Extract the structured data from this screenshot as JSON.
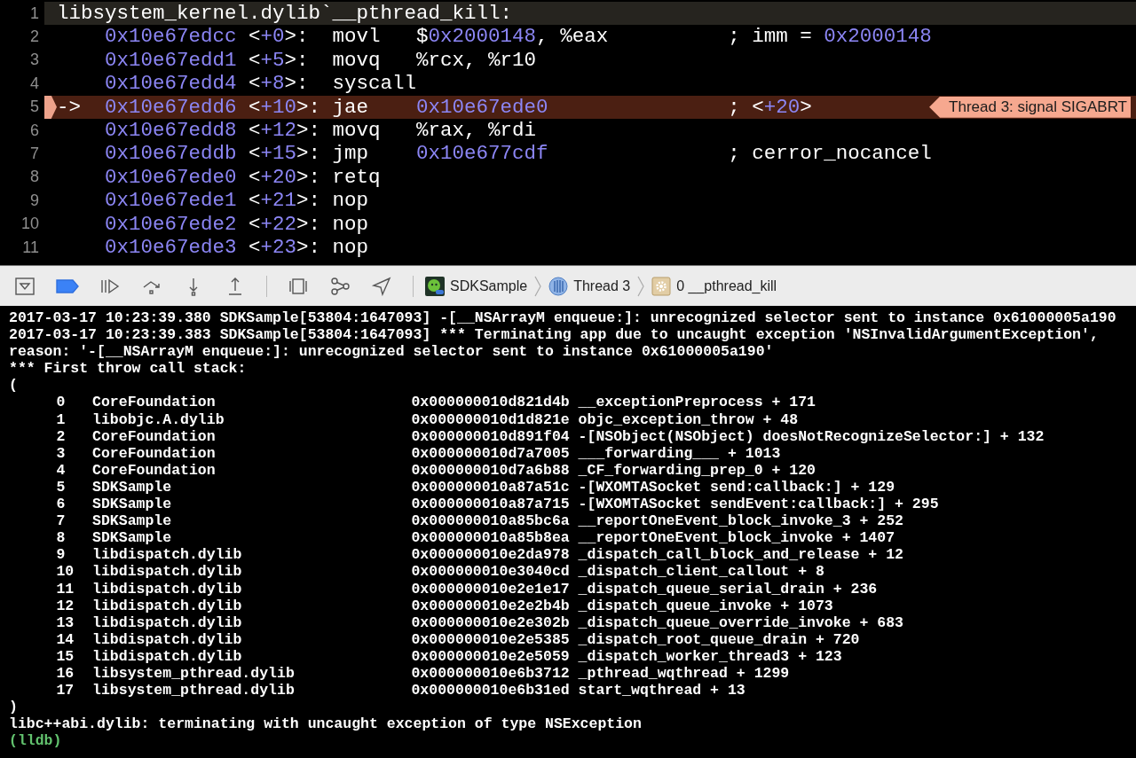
{
  "code_lines": [
    {
      "number": "1",
      "kind": "label",
      "current": false,
      "tokens": [
        {
          "text": "libsystem_kernel.dylib`__pthread_kill:",
          "kind": "plain"
        }
      ]
    },
    {
      "number": "2",
      "kind": "instruction",
      "current": false,
      "tokens": [
        {
          "text": "0x10e67edcc",
          "kind": "number"
        },
        {
          "text": " <",
          "kind": "plain"
        },
        {
          "text": "+0",
          "kind": "number"
        },
        {
          "text": ">:  movl   $",
          "kind": "plain"
        },
        {
          "text": "0x2000148",
          "kind": "number"
        },
        {
          "text": ", %eax          ; imm = ",
          "kind": "plain"
        },
        {
          "text": "0x2000148",
          "kind": "number"
        }
      ]
    },
    {
      "number": "3",
      "kind": "instruction",
      "current": false,
      "tokens": [
        {
          "text": "0x10e67edd1",
          "kind": "number"
        },
        {
          "text": " <",
          "kind": "plain"
        },
        {
          "text": "+5",
          "kind": "number"
        },
        {
          "text": ">:  movq   %rcx, %r10",
          "kind": "plain"
        }
      ]
    },
    {
      "number": "4",
      "kind": "instruction",
      "current": false,
      "tokens": [
        {
          "text": "0x10e67edd4",
          "kind": "number"
        },
        {
          "text": " <",
          "kind": "plain"
        },
        {
          "text": "+8",
          "kind": "number"
        },
        {
          "text": ">:  syscall",
          "kind": "plain"
        }
      ]
    },
    {
      "number": "5",
      "kind": "instruction",
      "current": true,
      "pointer": "->",
      "annotation": "Thread 3: signal SIGABRT",
      "tokens": [
        {
          "text": "0x10e67edd6",
          "kind": "number"
        },
        {
          "text": " <",
          "kind": "plain"
        },
        {
          "text": "+10",
          "kind": "number"
        },
        {
          "text": ">: jae    ",
          "kind": "plain"
        },
        {
          "text": "0x10e67ede0",
          "kind": "number"
        },
        {
          "text": "               ; <",
          "kind": "plain"
        },
        {
          "text": "+20",
          "kind": "number"
        },
        {
          "text": ">",
          "kind": "plain"
        }
      ]
    },
    {
      "number": "6",
      "kind": "instruction",
      "current": false,
      "tokens": [
        {
          "text": "0x10e67edd8",
          "kind": "number"
        },
        {
          "text": " <",
          "kind": "plain"
        },
        {
          "text": "+12",
          "kind": "number"
        },
        {
          "text": ">: movq   %rax, %rdi",
          "kind": "plain"
        }
      ]
    },
    {
      "number": "7",
      "kind": "instruction",
      "current": false,
      "tokens": [
        {
          "text": "0x10e67eddb",
          "kind": "number"
        },
        {
          "text": " <",
          "kind": "plain"
        },
        {
          "text": "+15",
          "kind": "number"
        },
        {
          "text": ">: jmp    ",
          "kind": "plain"
        },
        {
          "text": "0x10e677cdf",
          "kind": "number"
        },
        {
          "text": "               ; cerror_nocancel",
          "kind": "plain"
        }
      ]
    },
    {
      "number": "8",
      "kind": "instruction",
      "current": false,
      "tokens": [
        {
          "text": "0x10e67ede0",
          "kind": "number"
        },
        {
          "text": " <",
          "kind": "plain"
        },
        {
          "text": "+20",
          "kind": "number"
        },
        {
          "text": ">: retq",
          "kind": "plain"
        }
      ]
    },
    {
      "number": "9",
      "kind": "instruction",
      "current": false,
      "tokens": [
        {
          "text": "0x10e67ede1",
          "kind": "number"
        },
        {
          "text": " <",
          "kind": "plain"
        },
        {
          "text": "+21",
          "kind": "number"
        },
        {
          "text": ">: nop",
          "kind": "plain"
        }
      ]
    },
    {
      "number": "10",
      "kind": "instruction",
      "current": false,
      "tokens": [
        {
          "text": "0x10e67ede2",
          "kind": "number"
        },
        {
          "text": " <",
          "kind": "plain"
        },
        {
          "text": "+22",
          "kind": "number"
        },
        {
          "text": ">: nop",
          "kind": "plain"
        }
      ]
    },
    {
      "number": "11",
      "kind": "instruction",
      "current": false,
      "tokens": [
        {
          "text": "0x10e67ede3",
          "kind": "number"
        },
        {
          "text": " <",
          "kind": "plain"
        },
        {
          "text": "+23",
          "kind": "number"
        },
        {
          "text": ">: nop",
          "kind": "plain"
        }
      ]
    }
  ],
  "debug_bar": {
    "breakpoints_active": true,
    "breadcrumbs": [
      {
        "kind": "app",
        "label": "SDKSample"
      },
      {
        "kind": "thread",
        "label": "Thread 3"
      },
      {
        "kind": "frame",
        "label": "0 __pthread_kill"
      }
    ]
  },
  "console": {
    "entries": [
      {
        "kind": "text",
        "text": "2017-03-17 10:23:39.380 SDKSample[53804:1647093] -[__NSArrayM enqueue:]: unrecognized selector sent to instance 0x61000005a190"
      },
      {
        "kind": "text",
        "text": "2017-03-17 10:23:39.383 SDKSample[53804:1647093] *** Terminating app due to uncaught exception 'NSInvalidArgumentException',"
      },
      {
        "kind": "text",
        "text": "reason: '-[__NSArrayM enqueue:]: unrecognized selector sent to instance 0x61000005a190'"
      },
      {
        "kind": "text",
        "text": "*** First throw call stack:"
      },
      {
        "kind": "text",
        "text": "("
      },
      {
        "kind": "frame",
        "index": "0",
        "library": "CoreFoundation",
        "address": "0x000000010d821d4b",
        "symbol": "__exceptionPreprocess + 171"
      },
      {
        "kind": "frame",
        "index": "1",
        "library": "libobjc.A.dylib",
        "address": "0x000000010d1d821e",
        "symbol": "objc_exception_throw + 48"
      },
      {
        "kind": "frame",
        "index": "2",
        "library": "CoreFoundation",
        "address": "0x000000010d891f04",
        "symbol": "-[NSObject(NSObject) doesNotRecognizeSelector:] + 132"
      },
      {
        "kind": "frame",
        "index": "3",
        "library": "CoreFoundation",
        "address": "0x000000010d7a7005",
        "symbol": "___forwarding___ + 1013"
      },
      {
        "kind": "frame",
        "index": "4",
        "library": "CoreFoundation",
        "address": "0x000000010d7a6b88",
        "symbol": "_CF_forwarding_prep_0 + 120"
      },
      {
        "kind": "frame",
        "index": "5",
        "library": "SDKSample",
        "address": "0x000000010a87a51c",
        "symbol": "-[WXOMTASocket send:callback:] + 129"
      },
      {
        "kind": "frame",
        "index": "6",
        "library": "SDKSample",
        "address": "0x000000010a87a715",
        "symbol": "-[WXOMTASocket sendEvent:callback:] + 295"
      },
      {
        "kind": "frame",
        "index": "7",
        "library": "SDKSample",
        "address": "0x000000010a85bc6a",
        "symbol": "__reportOneEvent_block_invoke_3 + 252"
      },
      {
        "kind": "frame",
        "index": "8",
        "library": "SDKSample",
        "address": "0x000000010a85b8ea",
        "symbol": "__reportOneEvent_block_invoke + 1407"
      },
      {
        "kind": "frame",
        "index": "9",
        "library": "libdispatch.dylib",
        "address": "0x000000010e2da978",
        "symbol": "_dispatch_call_block_and_release + 12"
      },
      {
        "kind": "frame",
        "index": "10",
        "library": "libdispatch.dylib",
        "address": "0x000000010e3040cd",
        "symbol": "_dispatch_client_callout + 8"
      },
      {
        "kind": "frame",
        "index": "11",
        "library": "libdispatch.dylib",
        "address": "0x000000010e2e1e17",
        "symbol": "_dispatch_queue_serial_drain + 236"
      },
      {
        "kind": "frame",
        "index": "12",
        "library": "libdispatch.dylib",
        "address": "0x000000010e2e2b4b",
        "symbol": "_dispatch_queue_invoke + 1073"
      },
      {
        "kind": "frame",
        "index": "13",
        "library": "libdispatch.dylib",
        "address": "0x000000010e2e302b",
        "symbol": "_dispatch_queue_override_invoke + 683"
      },
      {
        "kind": "frame",
        "index": "14",
        "library": "libdispatch.dylib",
        "address": "0x000000010e2e5385",
        "symbol": "_dispatch_root_queue_drain + 720"
      },
      {
        "kind": "frame",
        "index": "15",
        "library": "libdispatch.dylib",
        "address": "0x000000010e2e5059",
        "symbol": "_dispatch_worker_thread3 + 123"
      },
      {
        "kind": "frame",
        "index": "16",
        "library": "libsystem_pthread.dylib",
        "address": "0x000000010e6b3712",
        "symbol": "_pthread_wqthread + 1299"
      },
      {
        "kind": "frame",
        "index": "17",
        "library": "libsystem_pthread.dylib",
        "address": "0x000000010e6b31ed",
        "symbol": "start_wqthread + 13"
      },
      {
        "kind": "text",
        "text": ")"
      },
      {
        "kind": "text",
        "text": "libc++abi.dylib: terminating with uncaught exception of type NSException"
      },
      {
        "kind": "prompt",
        "text": "(lldb)"
      }
    ]
  }
}
